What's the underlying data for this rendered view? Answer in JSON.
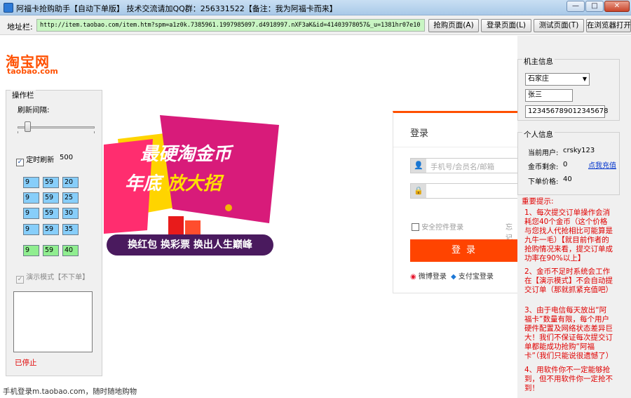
{
  "window": {
    "title": "阿福卡抢购助手【自动下单版】 技术交流请加QQ群：256331522【备注：我为阿福卡而来】",
    "minimize": "—",
    "maximize": "□",
    "close": "✕"
  },
  "toolbar": {
    "address_label": "地址栏:",
    "address_value": "http://item.taobao.com/item.htm?spm=a1z0k.7385961.1997985097.d4918997.nXF3aK&id=41403978057&_u=1381hr07e10",
    "buttons": [
      "抢购页面(A)",
      "登录页面(L)",
      "测试页面(T)",
      "在浏览器打开"
    ]
  },
  "browser": {
    "logo_cn": "淘宝网",
    "logo_en": "taobao.com",
    "banner_line1": "最硬淘金币",
    "banner_line2_a": "年底",
    "banner_line2_b": "放大招",
    "banner_button": "换红包 换彩票 换出人生巅峰",
    "login": {
      "title": "登录",
      "username_placeholder": "手机号/会员名/邮箱",
      "password_placeholder": "",
      "safe_login": "安全控件登录",
      "forgot": "忘记",
      "login_button": "登录",
      "weibo": "微博登录",
      "alipay": "支付宝登录"
    },
    "bottom_text": "手机登录m.taobao.com，随时随地购物"
  },
  "operations": {
    "group_title": "操作栏",
    "refresh_interval_label": "刷新间隔:",
    "slider_level": 0.1,
    "timed_refresh_label": "定时刷新",
    "timed_refresh_value": "500",
    "times": [
      [
        "9",
        "59",
        "20"
      ],
      [
        "9",
        "59",
        "25"
      ],
      [
        "9",
        "59",
        "30"
      ],
      [
        "9",
        "59",
        "35"
      ]
    ],
    "current_time": [
      "9",
      "59",
      "40"
    ],
    "demo_mode_label": "演示模式【不下单】",
    "status": "已停止"
  },
  "machine_info": {
    "group_title": "机主信息",
    "city": "石家庄",
    "name": "张三",
    "id_number": "123456789012345678"
  },
  "personal_info": {
    "group_title": "个人信息",
    "current_user_label": "当前用户:",
    "current_user": "crsky123",
    "coins_label": "金币剩余:",
    "coins": "0",
    "recharge_link": "点我充值",
    "price_label": "下单价格:",
    "price": "40"
  },
  "notice": {
    "title": "重要提示:",
    "tips": [
      "1、每次提交订单操作会消耗您40个金币（这个价格与您找人代抢相比可能算是九牛一毛）【就目前作者的抢购情况来看，提交订单成功率在90%以上】",
      "2、金币不足时系统会工作在【演示模式】不会自动提交订单（那就抓紧充值吧）",
      "3、由于电信每天放出“阿福卡”数量有限，每个用户硬件配置及网络状态差异巨大！我们不保证每次提交订单都能成功抢购“阿福卡”（我们只能说很遗憾了）",
      "4、用软件你不一定能够抢到，但不用软件你一定抢不到！"
    ]
  },
  "colors": {
    "accent": "#ff5000",
    "address_bg": "#c9f5c3",
    "time_box": "#87cefa",
    "time_box_active": "#90ee90",
    "notice": "#e00000"
  }
}
